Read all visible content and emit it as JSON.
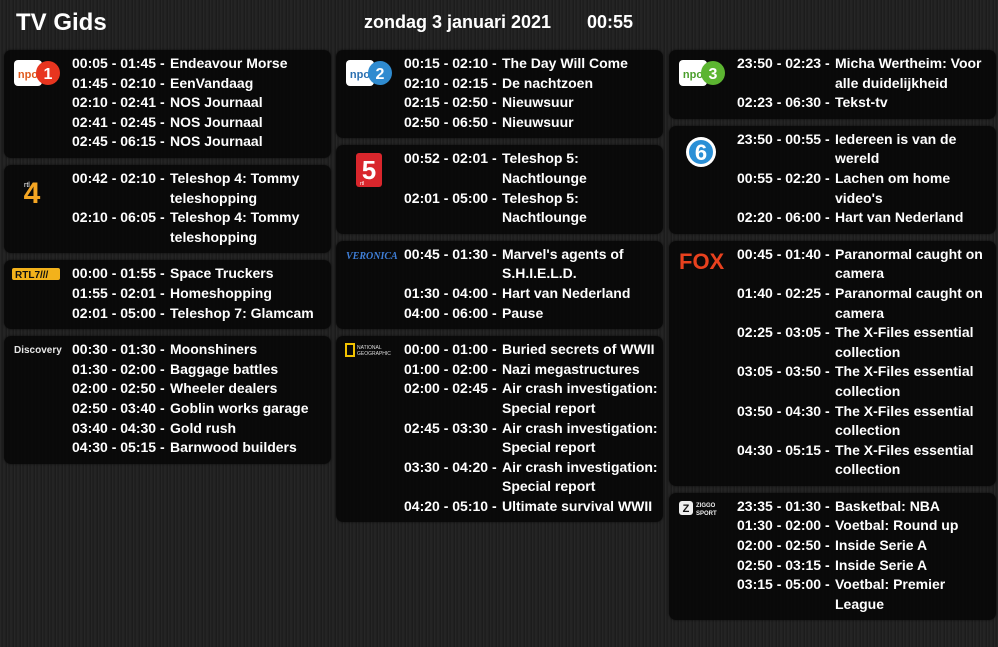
{
  "header": {
    "title": "TV Gids",
    "date": "zondag 3 januari 2021",
    "time": "00:55"
  },
  "logos": {
    "npo_text": "npo",
    "npo1_num": "1",
    "npo2_num": "2",
    "npo3_num": "3",
    "rtl4_small": "rtl",
    "rtl4_num": "4",
    "rtl7_text": "RTL7///",
    "discovery": "Discovery",
    "sbs6_num": "6",
    "rtl5_num": "5",
    "rtl5_small": "rtl",
    "veronica": "VERONICA",
    "natgeo_line1": "NATIONAL",
    "natgeo_line2": "GEOGRAPHIC",
    "fox": "FOX",
    "ziggo_line1": "ZIGGO",
    "ziggo_line2": "SPORT",
    "ziggo_mark": "Z"
  },
  "channels": [
    {
      "id": "npo1",
      "logo": "npo1-logo",
      "programs": [
        {
          "time": "00:05 - 01:45 -",
          "title": "Endeavour Morse"
        },
        {
          "time": "01:45 - 02:10 -",
          "title": "EenVandaag"
        },
        {
          "time": "02:10 - 02:41 -",
          "title": "NOS Journaal"
        },
        {
          "time": "02:41 - 02:45 -",
          "title": "NOS Journaal"
        },
        {
          "time": "02:45 - 06:15 -",
          "title": "NOS Journaal"
        }
      ]
    },
    {
      "id": "rtl4",
      "logo": "rtl4-logo",
      "programs": [
        {
          "time": "00:42 - 02:10 -",
          "title": "Teleshop 4: Tommy teleshopping"
        },
        {
          "time": "02:10 - 06:05 -",
          "title": "Teleshop 4: Tommy teleshopping"
        }
      ]
    },
    {
      "id": "rtl7",
      "logo": "rtl7-logo",
      "programs": [
        {
          "time": "00:00 - 01:55 -",
          "title": "Space Truckers"
        },
        {
          "time": "01:55 - 02:01 -",
          "title": "Homeshopping"
        },
        {
          "time": "02:01 - 05:00 -",
          "title": "Teleshop 7: Glamcam"
        }
      ]
    },
    {
      "id": "discovery",
      "logo": "discovery-logo",
      "programs": [
        {
          "time": "00:30 - 01:30 -",
          "title": "Moonshiners"
        },
        {
          "time": "01:30 - 02:00 -",
          "title": "Baggage battles"
        },
        {
          "time": "02:00 - 02:50 -",
          "title": "Wheeler dealers"
        },
        {
          "time": "02:50 - 03:40 -",
          "title": "Goblin works garage"
        },
        {
          "time": "03:40 - 04:30 -",
          "title": "Gold rush"
        },
        {
          "time": "04:30 - 05:15 -",
          "title": "Barnwood builders"
        }
      ]
    },
    {
      "id": "npo2",
      "logo": "npo2-logo",
      "programs": [
        {
          "time": "00:15 - 02:10 -",
          "title": "The Day Will Come"
        },
        {
          "time": "02:10 - 02:15 -",
          "title": "De nachtzoen"
        },
        {
          "time": "02:15 - 02:50 -",
          "title": "Nieuwsuur"
        },
        {
          "time": "02:50 - 06:50 -",
          "title": "Nieuwsuur"
        }
      ]
    },
    {
      "id": "rtl5",
      "logo": "rtl5-logo",
      "programs": [
        {
          "time": "00:52 - 02:01 -",
          "title": "Teleshop 5: Nachtlounge"
        },
        {
          "time": "02:01 - 05:00 -",
          "title": "Teleshop 5: Nachtlounge"
        }
      ]
    },
    {
      "id": "veronica",
      "logo": "veronica-logo",
      "programs": [
        {
          "time": "00:45 - 01:30 -",
          "title": "Marvel's agents of S.H.I.E.L.D."
        },
        {
          "time": "01:30 - 04:00 -",
          "title": "Hart van Nederland"
        },
        {
          "time": "04:00 - 06:00 -",
          "title": "Pause"
        }
      ]
    },
    {
      "id": "natgeo",
      "logo": "natgeo-logo",
      "programs": [
        {
          "time": "00:00 - 01:00 -",
          "title": "Buried secrets of WWII"
        },
        {
          "time": "01:00 - 02:00 -",
          "title": "Nazi megastructures"
        },
        {
          "time": "02:00 - 02:45 -",
          "title": "Air crash investigation: Special report"
        },
        {
          "time": "02:45 - 03:30 -",
          "title": "Air crash investigation: Special report"
        },
        {
          "time": "03:30 - 04:20 -",
          "title": "Air crash investigation: Special report"
        },
        {
          "time": "04:20 - 05:10 -",
          "title": "Ultimate survival WWII"
        }
      ]
    },
    {
      "id": "npo3",
      "logo": "npo3-logo",
      "programs": [
        {
          "time": "23:50 - 02:23 -",
          "title": "Micha Wertheim: Voor alle duidelijkheid"
        },
        {
          "time": "02:23 - 06:30 -",
          "title": "Tekst-tv"
        }
      ]
    },
    {
      "id": "sbs6",
      "logo": "sbs6-logo",
      "programs": [
        {
          "time": "23:50 - 00:55 -",
          "title": "Iedereen is van de wereld"
        },
        {
          "time": "00:55 - 02:20 -",
          "title": "Lachen om home video's"
        },
        {
          "time": "02:20 - 06:00 -",
          "title": "Hart van Nederland"
        }
      ]
    },
    {
      "id": "fox",
      "logo": "fox-logo",
      "programs": [
        {
          "time": "00:45 - 01:40 -",
          "title": "Paranormal caught on camera"
        },
        {
          "time": "01:40 - 02:25 -",
          "title": "Paranormal caught on camera"
        },
        {
          "time": "02:25 - 03:05 -",
          "title": "The X-Files essential collection"
        },
        {
          "time": "03:05 - 03:50 -",
          "title": "The X-Files essential collection"
        },
        {
          "time": "03:50 - 04:30 -",
          "title": "The X-Files essential collection"
        },
        {
          "time": "04:30 - 05:15 -",
          "title": "The X-Files essential collection"
        }
      ]
    },
    {
      "id": "ziggo",
      "logo": "ziggo-sport-logo",
      "programs": [
        {
          "time": "23:35 - 01:30 -",
          "title": "Basketbal: NBA"
        },
        {
          "time": "01:30 - 02:00 -",
          "title": "Voetbal: Round up"
        },
        {
          "time": "02:00 - 02:50 -",
          "title": "Inside Serie A"
        },
        {
          "time": "02:50 - 03:15 -",
          "title": "Inside Serie A"
        },
        {
          "time": "03:15 - 05:00 -",
          "title": "Voetbal: Premier League"
        }
      ]
    }
  ]
}
